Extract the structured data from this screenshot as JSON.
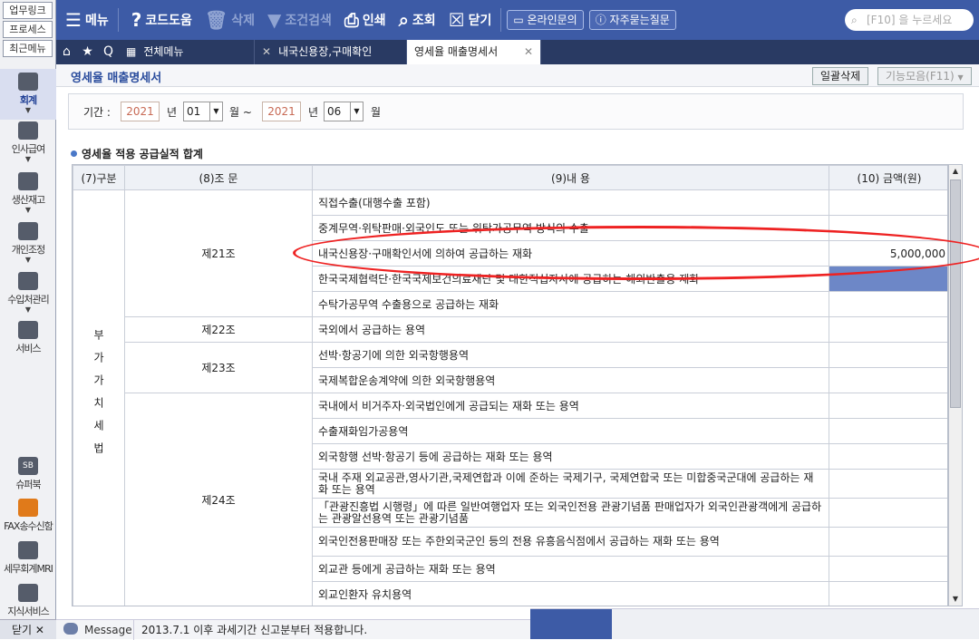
{
  "sidebar": {
    "top_links": [
      "업무링크",
      "프로세스",
      "최근메뉴"
    ],
    "items": [
      {
        "label": "회계",
        "icon": "calculator-icon",
        "active": true
      },
      {
        "label": "인사급여",
        "icon": "person-coin-icon"
      },
      {
        "label": "생산재고",
        "icon": "grid-icon"
      },
      {
        "label": "개인조정",
        "icon": "person-icon"
      },
      {
        "label": "수입처관리",
        "icon": "building-icon"
      },
      {
        "label": "서비스",
        "icon": "monitor-icon"
      },
      {
        "label": "슈퍼북",
        "icon": "sb-book-icon",
        "badge": "SB"
      },
      {
        "label": "FAX송수신함",
        "icon": "fax-icon"
      },
      {
        "label": "세무회계MRI",
        "icon": "pulse-icon"
      },
      {
        "label": "지식서비스",
        "icon": "book-icon"
      }
    ],
    "close_label": "닫기"
  },
  "toolbar": {
    "menu": "메뉴",
    "code_help": "코드도움",
    "delete": "삭제",
    "condition_search": "조건검색",
    "print": "인쇄",
    "lookup": "조회",
    "close": "닫기",
    "online_inquiry": "온라인문의",
    "faq": "자주묻는질문",
    "search_placeholder": "[F10] 을 누르세요"
  },
  "tabs": [
    {
      "label": "전체메뉴"
    },
    {
      "label": "내국신용장,구매확인"
    },
    {
      "label": "영세율 매출명세서",
      "active": true
    }
  ],
  "page": {
    "title": "영세율 매출명세서",
    "bulk_delete": "일괄삭제",
    "function_collection": "기능모음(F11)"
  },
  "filter": {
    "period_label": "기간 :",
    "start_year": "2021",
    "year_label": "년",
    "start_month": "01",
    "month_sep": "월 ~",
    "end_year": "2021",
    "end_month": "06",
    "month_label": "월"
  },
  "section_title": "영세율 적용 공급실적 합계",
  "table": {
    "headers": [
      "(7)구분",
      "(8)조   문",
      "(9)내              용",
      "(10) 금액(원)"
    ],
    "category": "부가가치세법",
    "groups": [
      {
        "article": "제21조",
        "rows": [
          {
            "content": "직접수출(대행수출 포함)",
            "amount": ""
          },
          {
            "content": "중계무역·위탁판매·외국인도 또는 위탁가공무역 방식의 수출",
            "amount": ""
          },
          {
            "content": "내국신용장·구매확인서에 의하여 공급하는 재화",
            "amount": "5,000,000"
          },
          {
            "content": "한국국제협력단·한국국제보건의료재단 및 대한적십자사에 공급하는 해외반출용 재화",
            "amount": "",
            "selected": true
          },
          {
            "content": "수탁가공무역 수출용으로 공급하는 재화",
            "amount": ""
          }
        ]
      },
      {
        "article": "제22조",
        "rows": [
          {
            "content": "국외에서 공급하는 용역",
            "amount": ""
          }
        ]
      },
      {
        "article": "제23조",
        "rows": [
          {
            "content": "선박·항공기에 의한 외국항행용역",
            "amount": ""
          },
          {
            "content": "국제복합운송계약에 의한 외국항행용역",
            "amount": ""
          }
        ]
      },
      {
        "article": "제24조",
        "rows": [
          {
            "content": "국내에서 비거주자·외국법인에게 공급되는 재화 또는 용역",
            "amount": ""
          },
          {
            "content": "수출재화임가공용역",
            "amount": ""
          },
          {
            "content": "외국항행 선박·항공기 등에 공급하는 재화 또는 용역",
            "amount": ""
          },
          {
            "content": "국내 주재 외교공관,영사기관,국제연합과 이에 준하는 국제기구, 국제연합국 또는 미합중국군대에 공급하는 재화 또는 용역",
            "amount": "",
            "tall": true
          },
          {
            "content": "「관광진흥법 시행령」에 따른 일반여행업자 또는 외국인전용 관광기념품 판매업자가 외국인관광객에게 공급하는 관광알선용역 또는 관광기념품",
            "amount": "",
            "tall": true
          },
          {
            "content": "외국인전용판매장 또는 주한외국군인 등의 전용 유흥음식점에서 공급하는 재화 또는 용역",
            "amount": "",
            "tall": true
          },
          {
            "content": "외교관 등에게 공급하는 재화 또는 용역",
            "amount": ""
          },
          {
            "content": "외교인환자 유치용역",
            "amount": ""
          }
        ]
      }
    ]
  },
  "message": {
    "label": "Message",
    "text": "2013.7.1 이후 과세기간 신고분부터 적용합니다."
  }
}
